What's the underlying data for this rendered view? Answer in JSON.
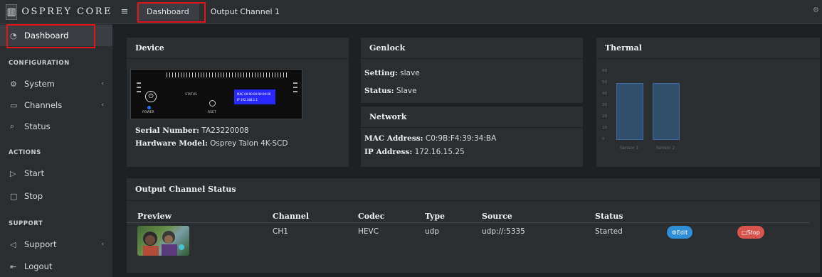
{
  "brand": {
    "logo_glyph": "▥",
    "name": "OSPREY CORE"
  },
  "sidebar": {
    "items": [
      {
        "label": "Dashboard",
        "icon": "dashboard-icon",
        "glyph": "◔"
      },
      {
        "label": "System",
        "icon": "gear-icon",
        "glyph": "⚙"
      },
      {
        "label": "Channels",
        "icon": "channel-icon",
        "glyph": "▭"
      },
      {
        "label": "Status",
        "icon": "search-icon",
        "glyph": "⌕"
      },
      {
        "label": "Start",
        "icon": "play-icon",
        "glyph": "▷"
      },
      {
        "label": "Stop",
        "icon": "stop-icon",
        "glyph": "□"
      },
      {
        "label": "Support",
        "icon": "send-icon",
        "glyph": "◁"
      },
      {
        "label": "Logout",
        "icon": "logout-icon",
        "glyph": "⇤"
      }
    ],
    "headers": {
      "configuration": "CONFIGURATION",
      "actions": "ACTIONS",
      "support": "SUPPORT"
    },
    "chevron": "‹"
  },
  "topbar": {
    "menu_glyph": "≡",
    "tabs": [
      "Dashboard",
      "Output Channel 1"
    ],
    "settings_glyph": "⚙"
  },
  "device": {
    "title": "Device",
    "serial_label": "Serial Number:",
    "serial_value": "TA23220008",
    "model_label": "Hardware Model:",
    "model_value": "Osprey Talon 4K-SCD",
    "image": {
      "power_glyph": "⏻",
      "status_label": "STATUS",
      "power_label": "POWER",
      "reset_label": "RSET",
      "lcd_mac": "MAC 00:00:00:00:00:00",
      "lcd_ip": "IP  192.168.1.1"
    }
  },
  "genlock": {
    "title": "Genlock",
    "setting_label": "Setting:",
    "setting_value": "slave",
    "status_label": "Status:",
    "status_value": "Slave"
  },
  "network": {
    "title": "Network",
    "mac_label": "MAC Address:",
    "mac_value": "C0:9B:F4:39:34:BA",
    "ip_label": "IP Address:",
    "ip_value": "172.16.15.25"
  },
  "thermal": {
    "title": "Thermal",
    "chart_data": {
      "type": "bar",
      "categories": [
        "Sensor 1",
        "Sensor 2"
      ],
      "values": [
        50,
        50
      ],
      "ylim": [
        0,
        60
      ],
      "yticks": [
        "60",
        "50",
        "40",
        "30",
        "20",
        "10",
        "0"
      ],
      "bar_color": "#2f4f6c"
    }
  },
  "output_status": {
    "title": "Output Channel Status",
    "columns": [
      "Preview",
      "Channel",
      "Codec",
      "Type",
      "Source",
      "Status"
    ],
    "rows": [
      {
        "channel": "CH1",
        "codec": "HEVC",
        "type": "udp",
        "source": "udp://:5335",
        "status": "Started",
        "edit_label": "Edit",
        "stop_label": "Stop",
        "edit_glyph": "⚙",
        "stop_glyph": "□"
      }
    ]
  },
  "colors": {
    "highlight": "#e0141b",
    "edit": "#2f8fd9",
    "stop": "#d9534f"
  }
}
